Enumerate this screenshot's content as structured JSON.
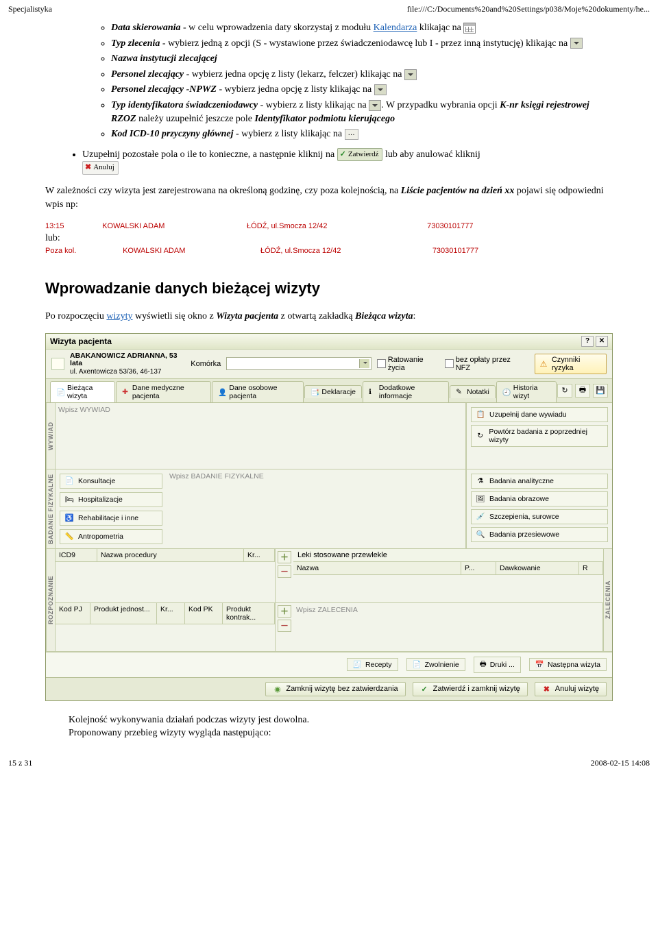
{
  "header": {
    "left": "Specjalistyka",
    "right": "file:///C:/Documents%20and%20Settings/p038/Moje%20dokumenty/he..."
  },
  "bullets": {
    "b1_pre": "Data skierowania",
    "b1_mid": " - w celu wprowadzenia daty skorzystaj z modułu ",
    "b1_link": "Kalendarza",
    "b1_post": " klikając na ",
    "b2_pre": "Typ zlecenia",
    "b2_post": " - wybierz jedną z opcji (S - wystawione przez świadczeniodawcę lub I - przez inną instytucję) klikając na ",
    "b3": "Nazwa instytucji zlecającej",
    "b4_pre": "Personel zlecający",
    "b4_post": " - wybierz jedna opcję z listy (lekarz, felczer) klikając na ",
    "b5_pre": "Personel zlecający -NPWZ",
    "b5_post": " - wybierz jedna opcję z listy klikając na ",
    "b6_pre": "Typ identyfikatora świadczeniodawcy",
    "b6_mid": " - wybierz z listy klikając na ",
    "b6_post": ". W przypadku wybrania opcji ",
    "b6_em2": "K-nr księgi rejestrowej RZOZ",
    "b6_tail": " należy uzupełnić jeszcze pole ",
    "b6_em3": "Identyfikator podmiotu kierującego",
    "b7_pre": "Kod ICD-10 przyczyny głównej",
    "b7_post": " - wybierz z listy klikając na ",
    "outer_pre": "Uzupełnij pozostałe pola o ile to konieczne, a następnie kliknij na ",
    "outer_post": " lub aby anulować kliknij "
  },
  "buttons": {
    "zatwierdz": "Zatwierdź",
    "anuluj": "Anuluj"
  },
  "para1_pre": "W zależności czy wizyta jest zarejestrowana na określoną godzinę, czy poza kolejnością, na ",
  "para1_em": "Liście pacjentów na dzień xx",
  "para1_post": " pojawi się odpowiedni wpis np:",
  "list_rows": [
    {
      "c0": "13:15",
      "c1": "KOWALSKI ADAM",
      "c2": "ŁÓDŹ, ul.Smocza 12/42",
      "c3": "73030101777"
    },
    {
      "lub": "lub:"
    },
    {
      "c0": "Poza kol.",
      "c1": "KOWALSKI ADAM",
      "c2": "ŁÓDŹ, ul.Smocza 12/42",
      "c3": "73030101777"
    }
  ],
  "h2": "Wprowadzanie danych bieżącej wizyty",
  "para2_pre": "Po rozpoczęciu ",
  "para2_link": "wizyty",
  "para2_mid": " wyświetli się okno z ",
  "para2_em1": "Wizyta pacjenta",
  "para2_mid2": " z otwartą zakładką ",
  "para2_em2": "Bieżąca wizyta",
  "para2_post": ":",
  "app": {
    "title": "Wizyta pacjenta",
    "help": "?",
    "close": "✕",
    "patient_name": "ABAKANOWICZ ADRIANNA,  53 lata",
    "patient_addr": "ul. Axentowicza 53/36, 46-137",
    "lbl_komorka": "Komórka",
    "chk_ratowanie": "Ratowanie życia",
    "chk_bezoplaty": "bez opłaty przez NFZ",
    "btn_czynniki": "Czynniki ryzyka",
    "tabs": [
      {
        "label": "Bieżąca wizyta",
        "active": true
      },
      {
        "label": "Dane medyczne pacjenta"
      },
      {
        "label": "Dane osobowe pacjenta"
      },
      {
        "label": "Deklaracje"
      },
      {
        "label": "Dodatkowe informacje"
      },
      {
        "label": "Notatki"
      },
      {
        "label": "Historia wizyt"
      }
    ],
    "ph_wywiad": "Wpisz WYWIAD",
    "side_wywiad": [
      {
        "label": "Uzupełnij dane wywiadu"
      },
      {
        "label": "Powtórz badania z poprzedniej wizyty"
      }
    ],
    "ph_badanie": "Wpisz BADANIE FIZYKALNE",
    "left_fiz": [
      "Konsultacje",
      "Hospitalizacje",
      "Rehabilitacje i inne",
      "Antropometria"
    ],
    "side_fiz": [
      "Badania analityczne",
      "Badania obrazowe",
      "Szczepienia, surowce",
      "Badania przesiewowe"
    ],
    "rozp_hdr": [
      "ICD9",
      "Nazwa procedury",
      "Kr..."
    ],
    "rozp_hdr2": [
      "Kod PJ",
      "Produkt jednost...",
      "Kr...",
      "Kod PK",
      "Produkt kontrak..."
    ],
    "leki_title": "Leki stosowane przewlekle",
    "leki_cols": [
      "Nazwa",
      "P...",
      "Dawkowanie",
      "R"
    ],
    "ph_zalecenia": "Wpisz ZALECENIA",
    "prebottom": [
      {
        "icon": "🧾",
        "label": "Recepty"
      },
      {
        "icon": "📄",
        "label": "Zwolnienie"
      },
      {
        "icon": "🖶",
        "label": "Druki ..."
      },
      {
        "icon": "📅",
        "label": "Następna wizyta"
      }
    ],
    "bottom": [
      {
        "cls": "stop",
        "label": "Zamknij wizytę bez zatwierdzania"
      },
      {
        "cls": "ok",
        "label": "Zatwierdź i zamknij wizytę"
      },
      {
        "cls": "x",
        "label": "Anuluj wizytę"
      }
    ],
    "vlabels": {
      "wywiad": "WYWIAD",
      "badanie": "BADANIE FIZYKALNE",
      "rozp": "ROZPOZNANIE",
      "zal": "ZALECENIA"
    }
  },
  "post1": "Kolejność wykonywania działań podczas wizyty jest dowolna.",
  "post2": "Proponowany przebieg wizyty wygląda następująco:",
  "footer": {
    "left": "15 z 31",
    "right": "2008-02-15 14:08"
  }
}
